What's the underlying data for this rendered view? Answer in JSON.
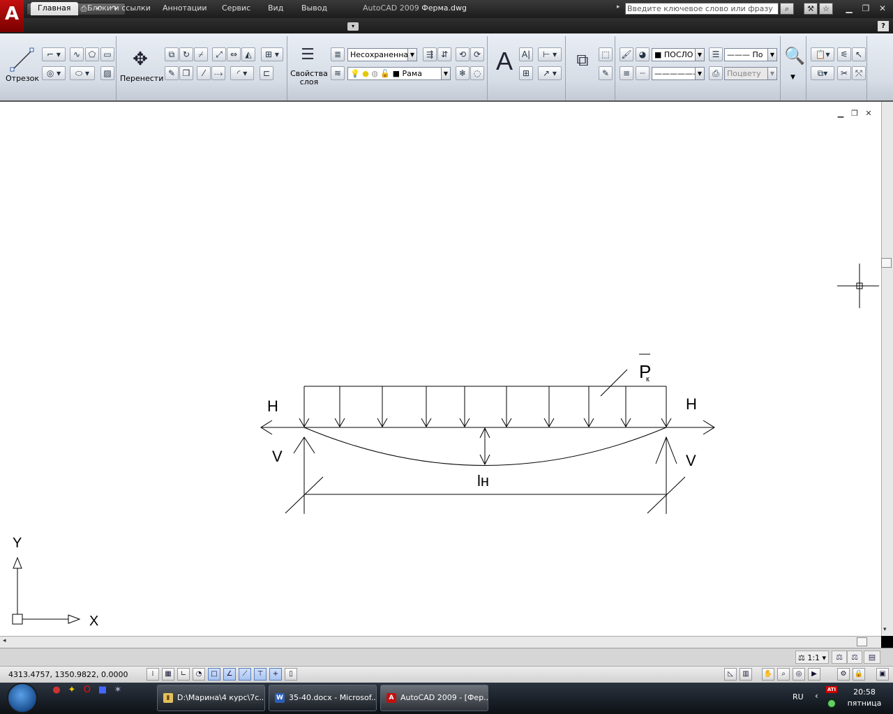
{
  "titlebar": {
    "app_name": "AutoCAD 2009",
    "document": "Ферма.dwg",
    "search_placeholder": "Введите ключевое слово или фразу",
    "search_go_icon": "search-icon",
    "logo_letter": "A"
  },
  "quick_access": {
    "items": [
      "new-icon",
      "open-icon",
      "save-icon",
      "print-icon",
      "undo-icon",
      "redo-icon"
    ]
  },
  "ribbon_tabs": [
    "Главная",
    "Блоки и ссылки",
    "Аннотации",
    "Сервис",
    "Вид",
    "Вывод"
  ],
  "ribbon": {
    "draw": {
      "line_label": "Отрезок"
    },
    "modify": {
      "move_label": "Перенести"
    },
    "layers": {
      "properties_label": "Свойства слоя",
      "layer_state": "Несохраненная",
      "current_layer": "Рама"
    },
    "properties": {
      "color": "ПОСЛО",
      "linetype": "По",
      "plotstyle": "Поцвету"
    }
  },
  "drawing": {
    "load_label": "P",
    "load_subscript": "к",
    "h_left": "H",
    "h_right": "H",
    "v_left": "V",
    "v_right": "V",
    "span_label": "lн",
    "ucs_y": "Y",
    "ucs_x": "X"
  },
  "status": {
    "coords": "4313.4757, 1350.9822, 0.0000",
    "scale": "1:1"
  },
  "taskbar": {
    "tasks": [
      {
        "label": "D:\\Марина\\4 курс\\7с...",
        "icon": "folder-icon"
      },
      {
        "label": "35-40.docx - Microsof...",
        "icon": "word-icon"
      },
      {
        "label": "AutoCAD 2009 - [Фер...",
        "icon": "autocad-icon"
      }
    ],
    "lang": "RU",
    "time": "20:58",
    "day": "пятница"
  },
  "colors": {
    "accent": "#c41010",
    "canvas": "#ffffff",
    "taskbar": "#0d1116"
  }
}
